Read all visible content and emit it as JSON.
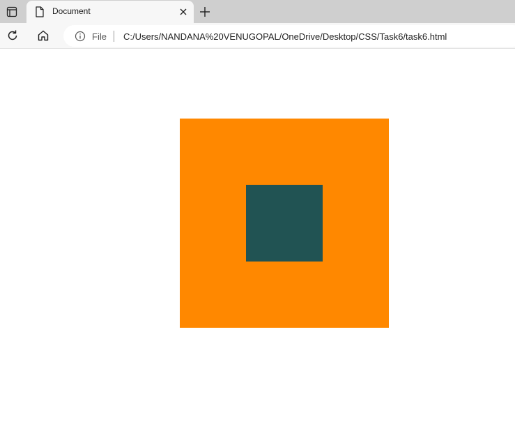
{
  "browser": {
    "tab": {
      "title": "Document"
    },
    "address_bar": {
      "scheme_label": "File",
      "url": "C:/Users/NANDANA%20VENUGOPAL/OneDrive/Desktop/CSS/Task6/task6.html"
    }
  },
  "page": {
    "outer_box": {
      "color": "#ff8800"
    },
    "inner_box": {
      "color": "#215353"
    }
  },
  "icons": {
    "tab_actions": "tab-actions-icon",
    "favicon": "document-icon",
    "close": "close-icon",
    "new_tab": "plus-icon",
    "refresh": "refresh-icon",
    "home": "home-icon",
    "info": "info-icon"
  }
}
